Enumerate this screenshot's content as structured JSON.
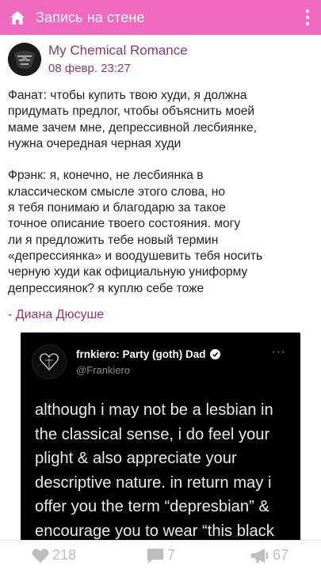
{
  "appbar": {
    "title": "Запись на стене",
    "home_icon": "home-icon",
    "menu_icon": "more-vertical-icon"
  },
  "post": {
    "author": "My Chemical Romance",
    "time": "08 февр. 23:27",
    "text": "Фанат: чтобы купить твою худи, я должна\nпридумать предлог, чтобы объяснить моей\nмаме зачем мне, депрессивной лесбиянке,\nнужна очередная черная худи\n\nФрэнк: я, конечно, не лесбиянка в\nклассическом смысле этого слова, но\nя тебя понимаю и благодарю за такое\nточное описание твоего состояния. могу\nли я предложить тебе новый термин\n«депрессиянка» и воодушевить тебя носить\nчерную худи как официальную униформу\nдепрессиянок? я куплю себе тоже",
    "signature": "- Диана Дюсуше"
  },
  "tweet": {
    "name": "frnkiero: Party (goth) Dad",
    "handle": "@Frankiero",
    "more": "···",
    "body": "although i may not be a lesbian in\nthe classical sense, i do feel your\nplight & also appreciate your\ndescriptive nature. in return may i\noffer you the term “depresbian” &\nencourage you to wear “this black"
  },
  "actions": {
    "likes": "218",
    "comments": "7",
    "reposts": "67"
  },
  "colors": {
    "accent": "#f06bbd",
    "author": "#8a3a6c",
    "icons": "#bdbdbd"
  }
}
